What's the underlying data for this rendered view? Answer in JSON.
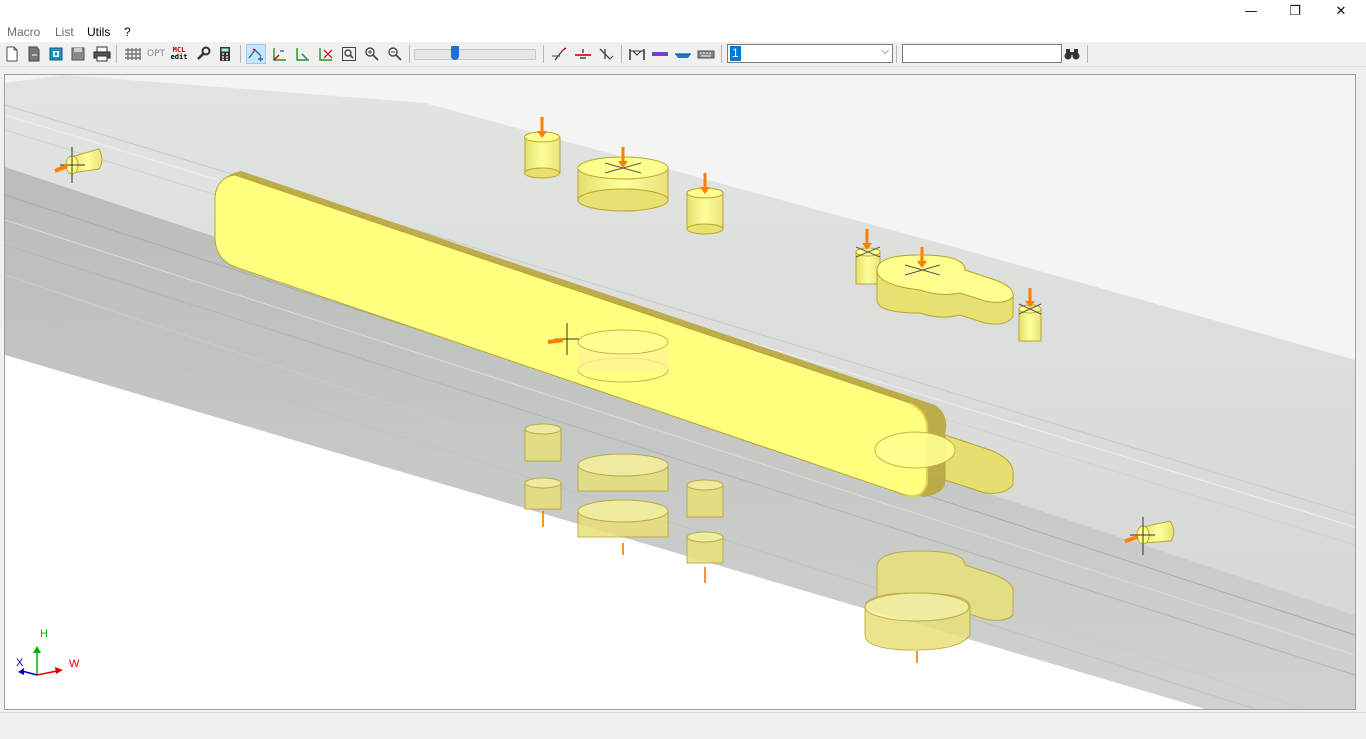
{
  "window": {
    "minimize": "—",
    "restore": "❐",
    "close": "✕"
  },
  "menu": {
    "items": [
      {
        "label": "Macro",
        "dim": true
      },
      {
        "label": "List",
        "dim": true
      },
      {
        "label": "Utils",
        "dim": false
      },
      {
        "label": "?",
        "dim": false
      }
    ]
  },
  "toolbar": {
    "opt_label": "OPT",
    "mcl_label": "MCL",
    "edit_label": "edit",
    "zoom_slider": {
      "value": 0.33
    },
    "layer_combo": {
      "selected": "1"
    },
    "search": {
      "value": ""
    }
  },
  "axes": {
    "h": "H",
    "x": "X",
    "w": "W"
  },
  "colors": {
    "accent": "#0078d7",
    "part_yellow": "#ffff80",
    "panel_gray": "#dcdedc",
    "arrow_orange": "#ff7f00"
  }
}
